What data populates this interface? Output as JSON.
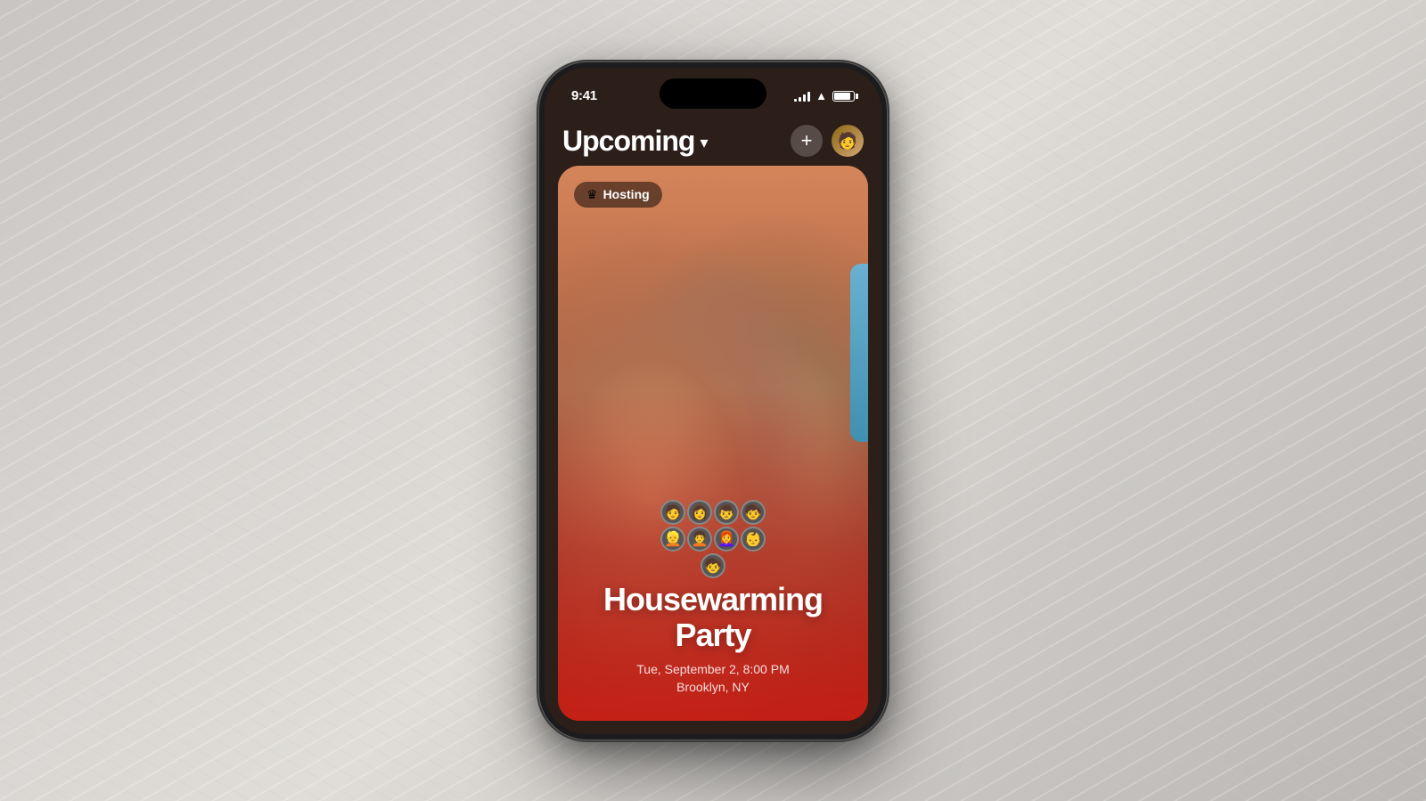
{
  "background": {
    "color": "#d0cece"
  },
  "phone": {
    "status_bar": {
      "time": "9:41",
      "signal_bars": [
        4,
        7,
        10,
        13
      ],
      "battery_percent": 85
    },
    "app": {
      "header": {
        "title": "Upcoming",
        "chevron": "▾",
        "add_button_label": "+",
        "avatar_emoji": "👤"
      },
      "event_card": {
        "hosting_badge": "Hosting",
        "crown_emoji": "♛",
        "event_name_line1": "Housewarming",
        "event_name_line2": "Party",
        "event_date": "Tue, September 2, 8:00 PM",
        "event_location": "Brooklyn, NY",
        "avatars": [
          "🧑",
          "👩",
          "👦",
          "🧒",
          "👱",
          "🧑‍🦱",
          "👩‍🦰",
          "👦",
          "🧒"
        ]
      }
    }
  }
}
